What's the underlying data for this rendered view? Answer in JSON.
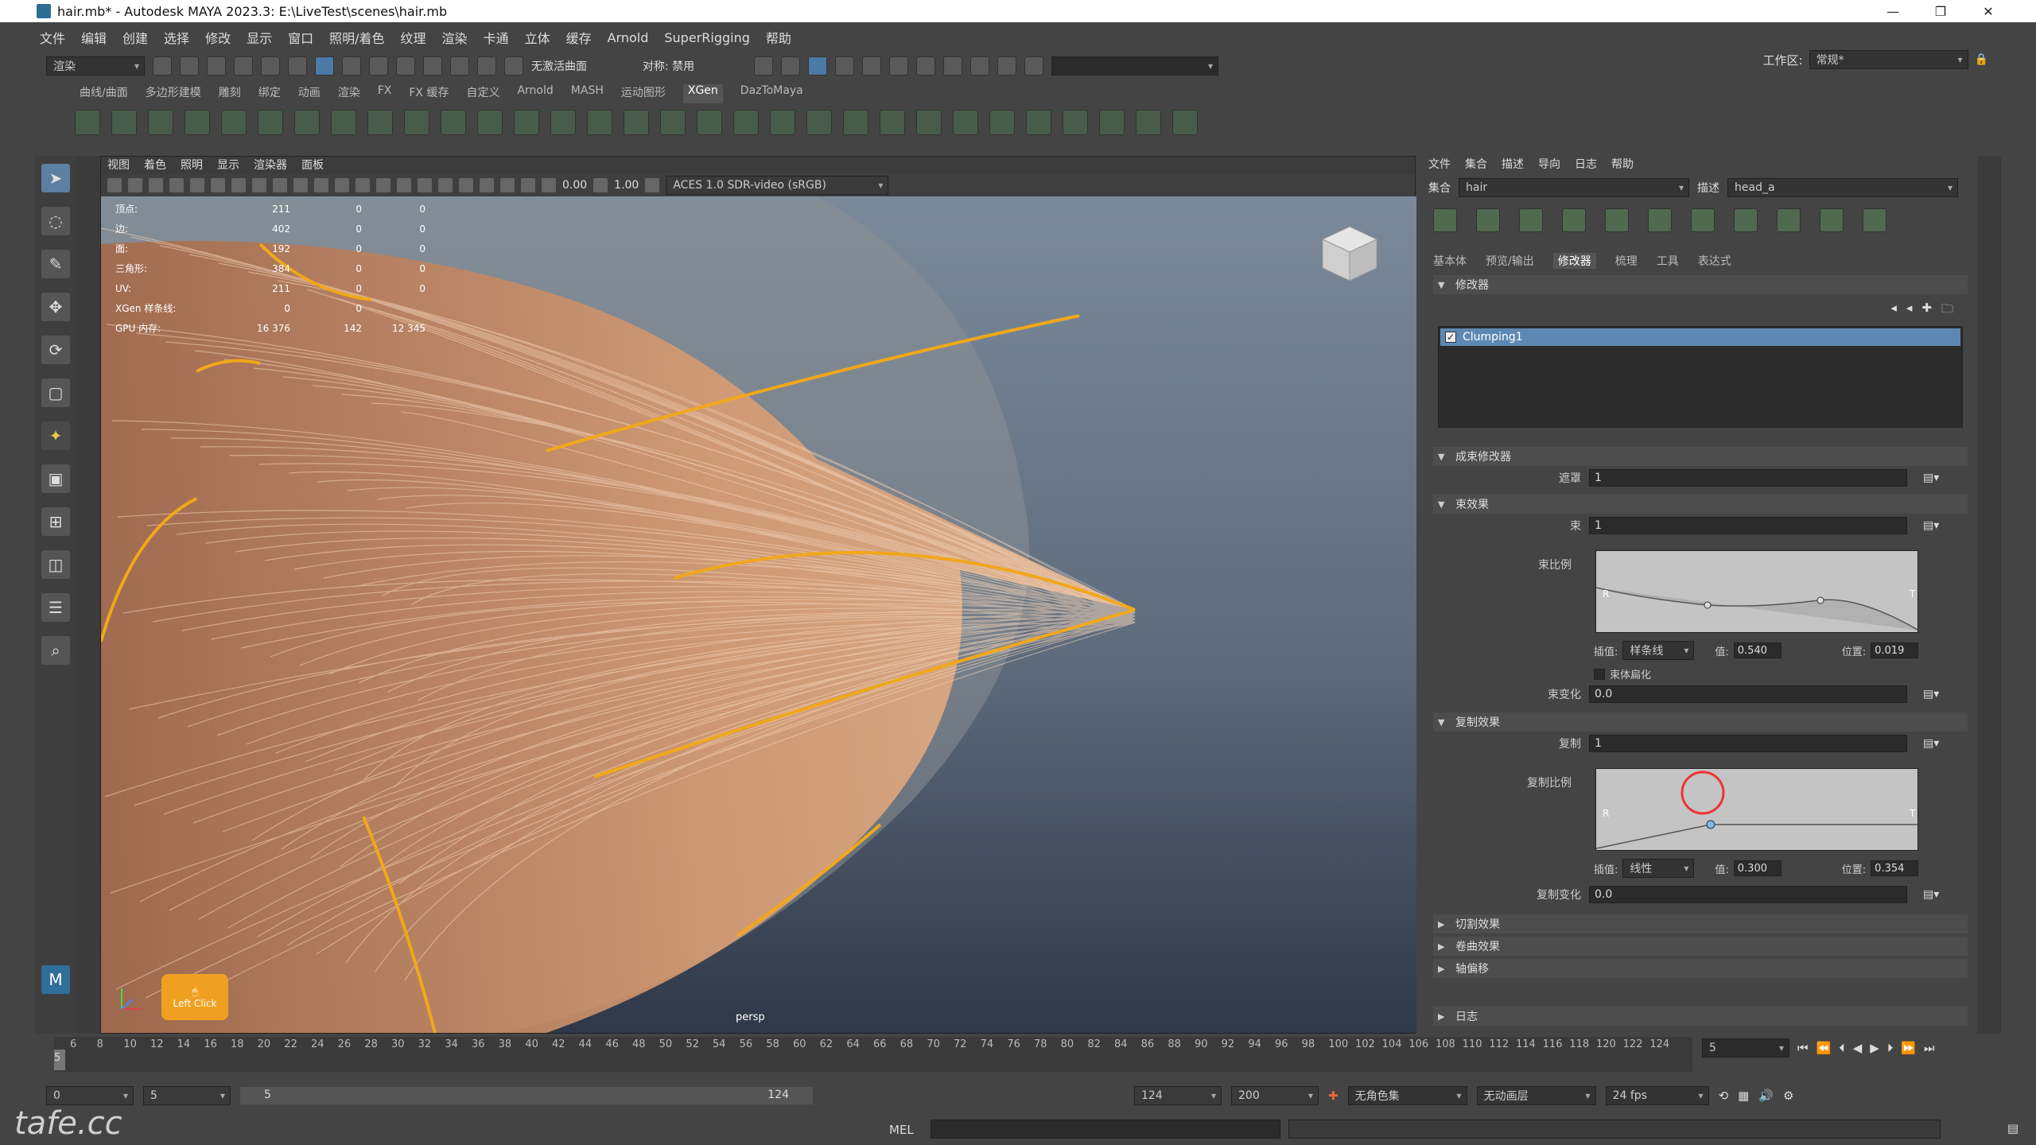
{
  "window": {
    "title": "hair.mb* - Autodesk MAYA 2023.3: E:\\LiveTest\\scenes\\hair.mb"
  },
  "menu": [
    "文件",
    "编辑",
    "创建",
    "选择",
    "修改",
    "显示",
    "窗口",
    "照明/着色",
    "纹理",
    "渲染",
    "卡通",
    "立体",
    "缓存",
    "Arnold",
    "SuperRigging",
    "帮助"
  ],
  "workspace": {
    "label": "工作区:",
    "value": "常规*"
  },
  "status": {
    "mode": "渲染",
    "curve_label": "无激活曲面",
    "symmetry": "对称: 禁用"
  },
  "shelf_tabs": [
    "曲线/曲面",
    "多边形建模",
    "雕刻",
    "绑定",
    "动画",
    "渲染",
    "FX",
    "FX 缓存",
    "自定义",
    "Arnold",
    "MASH",
    "运动图形",
    "XGen",
    "DazToMaya"
  ],
  "shelf_active": "XGen",
  "viewport": {
    "menu": [
      "视图",
      "着色",
      "照明",
      "显示",
      "渲染器",
      "面板"
    ],
    "field1": "0.00",
    "field2": "1.00",
    "colorspace": "ACES 1.0 SDR-video (sRGB)",
    "camera": "persp",
    "hud": [
      {
        "label": "顶点:",
        "a": "211",
        "b": "0",
        "c": "0"
      },
      {
        "label": "边:",
        "a": "402",
        "b": "0",
        "c": "0"
      },
      {
        "label": "面:",
        "a": "192",
        "b": "0",
        "c": "0"
      },
      {
        "label": "三角形:",
        "a": "384",
        "b": "0",
        "c": "0"
      },
      {
        "label": "UV:",
        "a": "211",
        "b": "0",
        "c": "0"
      },
      {
        "label": "XGen 样条线:",
        "a": "0",
        "b": "0",
        "c": ""
      },
      {
        "label": "GPU 内存:",
        "a": "16 376",
        "b": "142",
        "c": "12 345"
      }
    ],
    "click_hint": "Left Click"
  },
  "xgen": {
    "menu": [
      "文件",
      "集合",
      "描述",
      "导向",
      "日志",
      "帮助"
    ],
    "collection_label": "集合",
    "collection": "hair",
    "description_label": "描述",
    "description": "head_a",
    "tabs": [
      "基本体",
      "预览/输出",
      "修改器",
      "梳理",
      "工具",
      "表达式"
    ],
    "active_tab": "修改器",
    "modifiers_section": "修改器",
    "modifier_item": "Clumping1",
    "clump_section": "成束修改器",
    "mask_label": "遮罩",
    "mask_value": "1",
    "clump_effect_section": "束效果",
    "clump_label": "束",
    "clump_value": "1",
    "clump_scale_label": "束比例",
    "interp_label": "插值:",
    "interp1": "样条线",
    "value_label": "值:",
    "value1": "0.540",
    "position_label": "位置:",
    "position1": "0.019",
    "clump_flatten": "束体扁化",
    "clump_var_label": "束变化",
    "clump_var_value": "0.0",
    "copy_section": "复制效果",
    "copy_label": "复制",
    "copy_value": "1",
    "copy_scale_label": "复制比例",
    "interp2": "线性",
    "value2": "0.300",
    "position2": "0.354",
    "copy_var_label": "复制变化",
    "copy_var_value": "0.0",
    "closed_sections": [
      "切割效果",
      "卷曲效果",
      "轴偏移"
    ],
    "log_section": "日志"
  },
  "timeline": {
    "ticks": [
      "6",
      "8",
      "10",
      "12",
      "14",
      "16",
      "18",
      "20",
      "22",
      "24",
      "26",
      "28",
      "30",
      "32",
      "34",
      "36",
      "38",
      "40",
      "42",
      "44",
      "46",
      "48",
      "50",
      "52",
      "54",
      "56",
      "58",
      "60",
      "62",
      "64",
      "66",
      "68",
      "70",
      "72",
      "74",
      "76",
      "78",
      "80",
      "82",
      "84",
      "86",
      "88",
      "90",
      "92",
      "94",
      "96",
      "98",
      "100",
      "102",
      "104",
      "106",
      "108",
      "110",
      "112",
      "114",
      "116",
      "118",
      "120",
      "122",
      "124"
    ],
    "start_marker": "5",
    "current_frame": "5"
  },
  "range": {
    "start": "0",
    "playstart": "5",
    "slider_start": "5",
    "slider_end": "124",
    "playend": "124",
    "end": "200",
    "char_set": "无角色集",
    "anim_layer": "无动画层",
    "fps": "24 fps"
  },
  "cmd": {
    "lang": "MEL"
  },
  "watermark": "tafe.cc",
  "colors": {
    "accent": "#5d88b3",
    "hair": "#c88a5c",
    "guide": "#f0a81a"
  }
}
